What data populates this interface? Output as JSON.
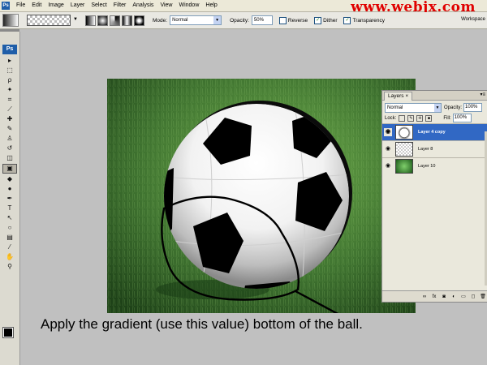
{
  "menubar": {
    "logo": "Ps",
    "items": [
      "File",
      "Edit",
      "Image",
      "Layer",
      "Select",
      "Filter",
      "Analysis",
      "View",
      "Window",
      "Help"
    ]
  },
  "watermark": "www.webjx.com",
  "options_bar": {
    "mode_label": "Mode:",
    "mode_value": "Normal",
    "opacity_label": "Opacity:",
    "opacity_value": "50%",
    "reverse_label": "Reverse",
    "dither_label": "Dither",
    "transparency_label": "Transparency",
    "workspace_label": "Workspace"
  },
  "toolbox": {
    "logo": "Ps",
    "tools": [
      {
        "name": "move-tool-icon",
        "glyph": "▸"
      },
      {
        "name": "marquee-tool-icon",
        "glyph": "⬚"
      },
      {
        "name": "lasso-tool-icon",
        "glyph": "ρ"
      },
      {
        "name": "magic-wand-tool-icon",
        "glyph": "✦"
      },
      {
        "name": "crop-tool-icon",
        "glyph": "⌗"
      },
      {
        "name": "slice-tool-icon",
        "glyph": "⟋"
      },
      {
        "name": "healing-brush-tool-icon",
        "glyph": "✚"
      },
      {
        "name": "brush-tool-icon",
        "glyph": "✎"
      },
      {
        "name": "clone-stamp-tool-icon",
        "glyph": "♙"
      },
      {
        "name": "history-brush-tool-icon",
        "glyph": "↺"
      },
      {
        "name": "eraser-tool-icon",
        "glyph": "◫"
      },
      {
        "name": "gradient-tool-icon",
        "glyph": "▣",
        "active": true
      },
      {
        "name": "blur-tool-icon",
        "glyph": "◆"
      },
      {
        "name": "dodge-tool-icon",
        "glyph": "●"
      },
      {
        "name": "pen-tool-icon",
        "glyph": "✒"
      },
      {
        "name": "type-tool-icon",
        "glyph": "T"
      },
      {
        "name": "path-selection-tool-icon",
        "glyph": "↖"
      },
      {
        "name": "shape-tool-icon",
        "glyph": "○"
      },
      {
        "name": "notes-tool-icon",
        "glyph": "▤"
      },
      {
        "name": "eyedropper-tool-icon",
        "glyph": "⁄"
      },
      {
        "name": "hand-tool-icon",
        "glyph": "✋"
      },
      {
        "name": "zoom-tool-icon",
        "glyph": "⚲"
      }
    ]
  },
  "caption": "Apply the gradient  (use this value) bottom of the ball.",
  "layers_panel": {
    "tab_label": "Layers",
    "close_glyph": "×",
    "blend_mode": "Normal",
    "opacity_label": "Opacity:",
    "opacity_value": "100%",
    "lock_label": "Lock:",
    "fill_label": "Fill:",
    "fill_value": "100%",
    "layers": [
      {
        "name": "Layer 4 copy",
        "thumb": "ball",
        "selected": true
      },
      {
        "name": "Layer 8",
        "thumb": "checker",
        "selected": false
      },
      {
        "name": "Layer 10",
        "thumb": "grass",
        "selected": false
      }
    ],
    "footer_icons": [
      "link-icon",
      "fx-icon",
      "mask-icon",
      "adjustment-icon",
      "group-icon",
      "new-layer-icon",
      "trash-icon"
    ]
  },
  "colors": {
    "watermark": "#e00000",
    "selected_layer": "#3168c4",
    "grass": "#3c6a2e"
  }
}
